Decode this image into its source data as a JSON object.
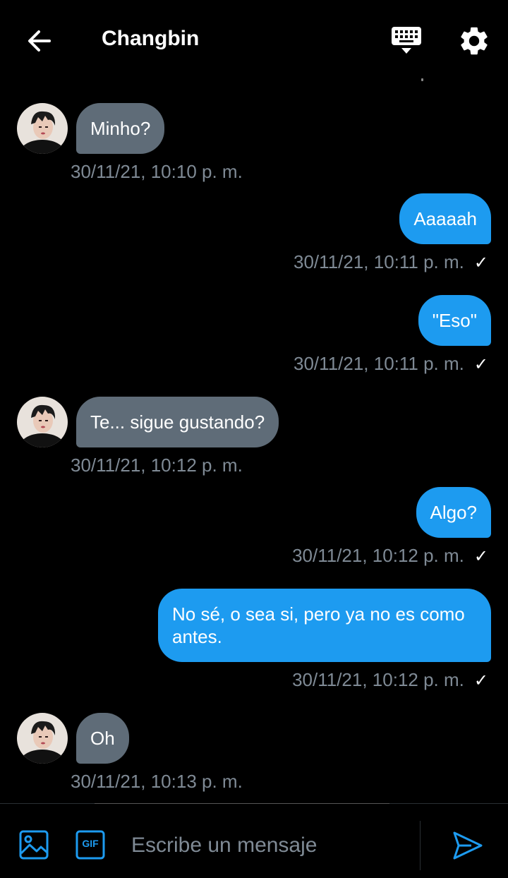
{
  "header": {
    "contact_name": "Changbin",
    "back_icon": "arrow-left-icon",
    "keyboard_icon": "keyboard-icon",
    "settings_icon": "gear-icon"
  },
  "messages": [
    {
      "direction": "incoming",
      "text": "Minho?",
      "timestamp": "30/11/21, 10:10 p. m."
    },
    {
      "direction": "outgoing",
      "text": "Aaaaah",
      "timestamp": "30/11/21, 10:11 p. m.",
      "read_mark": "✓"
    },
    {
      "direction": "outgoing",
      "text": "\"Eso\"",
      "timestamp": "30/11/21, 10:11 p. m.",
      "read_mark": "✓"
    },
    {
      "direction": "incoming",
      "text": "Te... sigue gustando?",
      "timestamp": "30/11/21, 10:12 p. m."
    },
    {
      "direction": "outgoing",
      "text": "Algo?",
      "timestamp": "30/11/21, 10:12 p. m.",
      "read_mark": "✓"
    },
    {
      "direction": "outgoing",
      "text": "No sé, o sea si, pero ya no es como antes.",
      "timestamp": "30/11/21, 10:12 p. m.",
      "read_mark": "✓"
    },
    {
      "direction": "incoming",
      "text": "Oh",
      "timestamp": "30/11/21, 10:13 p. m."
    }
  ],
  "composer": {
    "placeholder": "Escribe un mensaje",
    "image_icon": "image-icon",
    "gif_icon": "gif-icon",
    "gif_label": "GIF",
    "send_icon": "send-icon"
  },
  "colors": {
    "background": "#000000",
    "incoming_bubble": "#5f6c78",
    "outgoing_bubble": "#1d9bf0",
    "timestamp": "#7f8a95",
    "accent": "#1d9bf0"
  }
}
